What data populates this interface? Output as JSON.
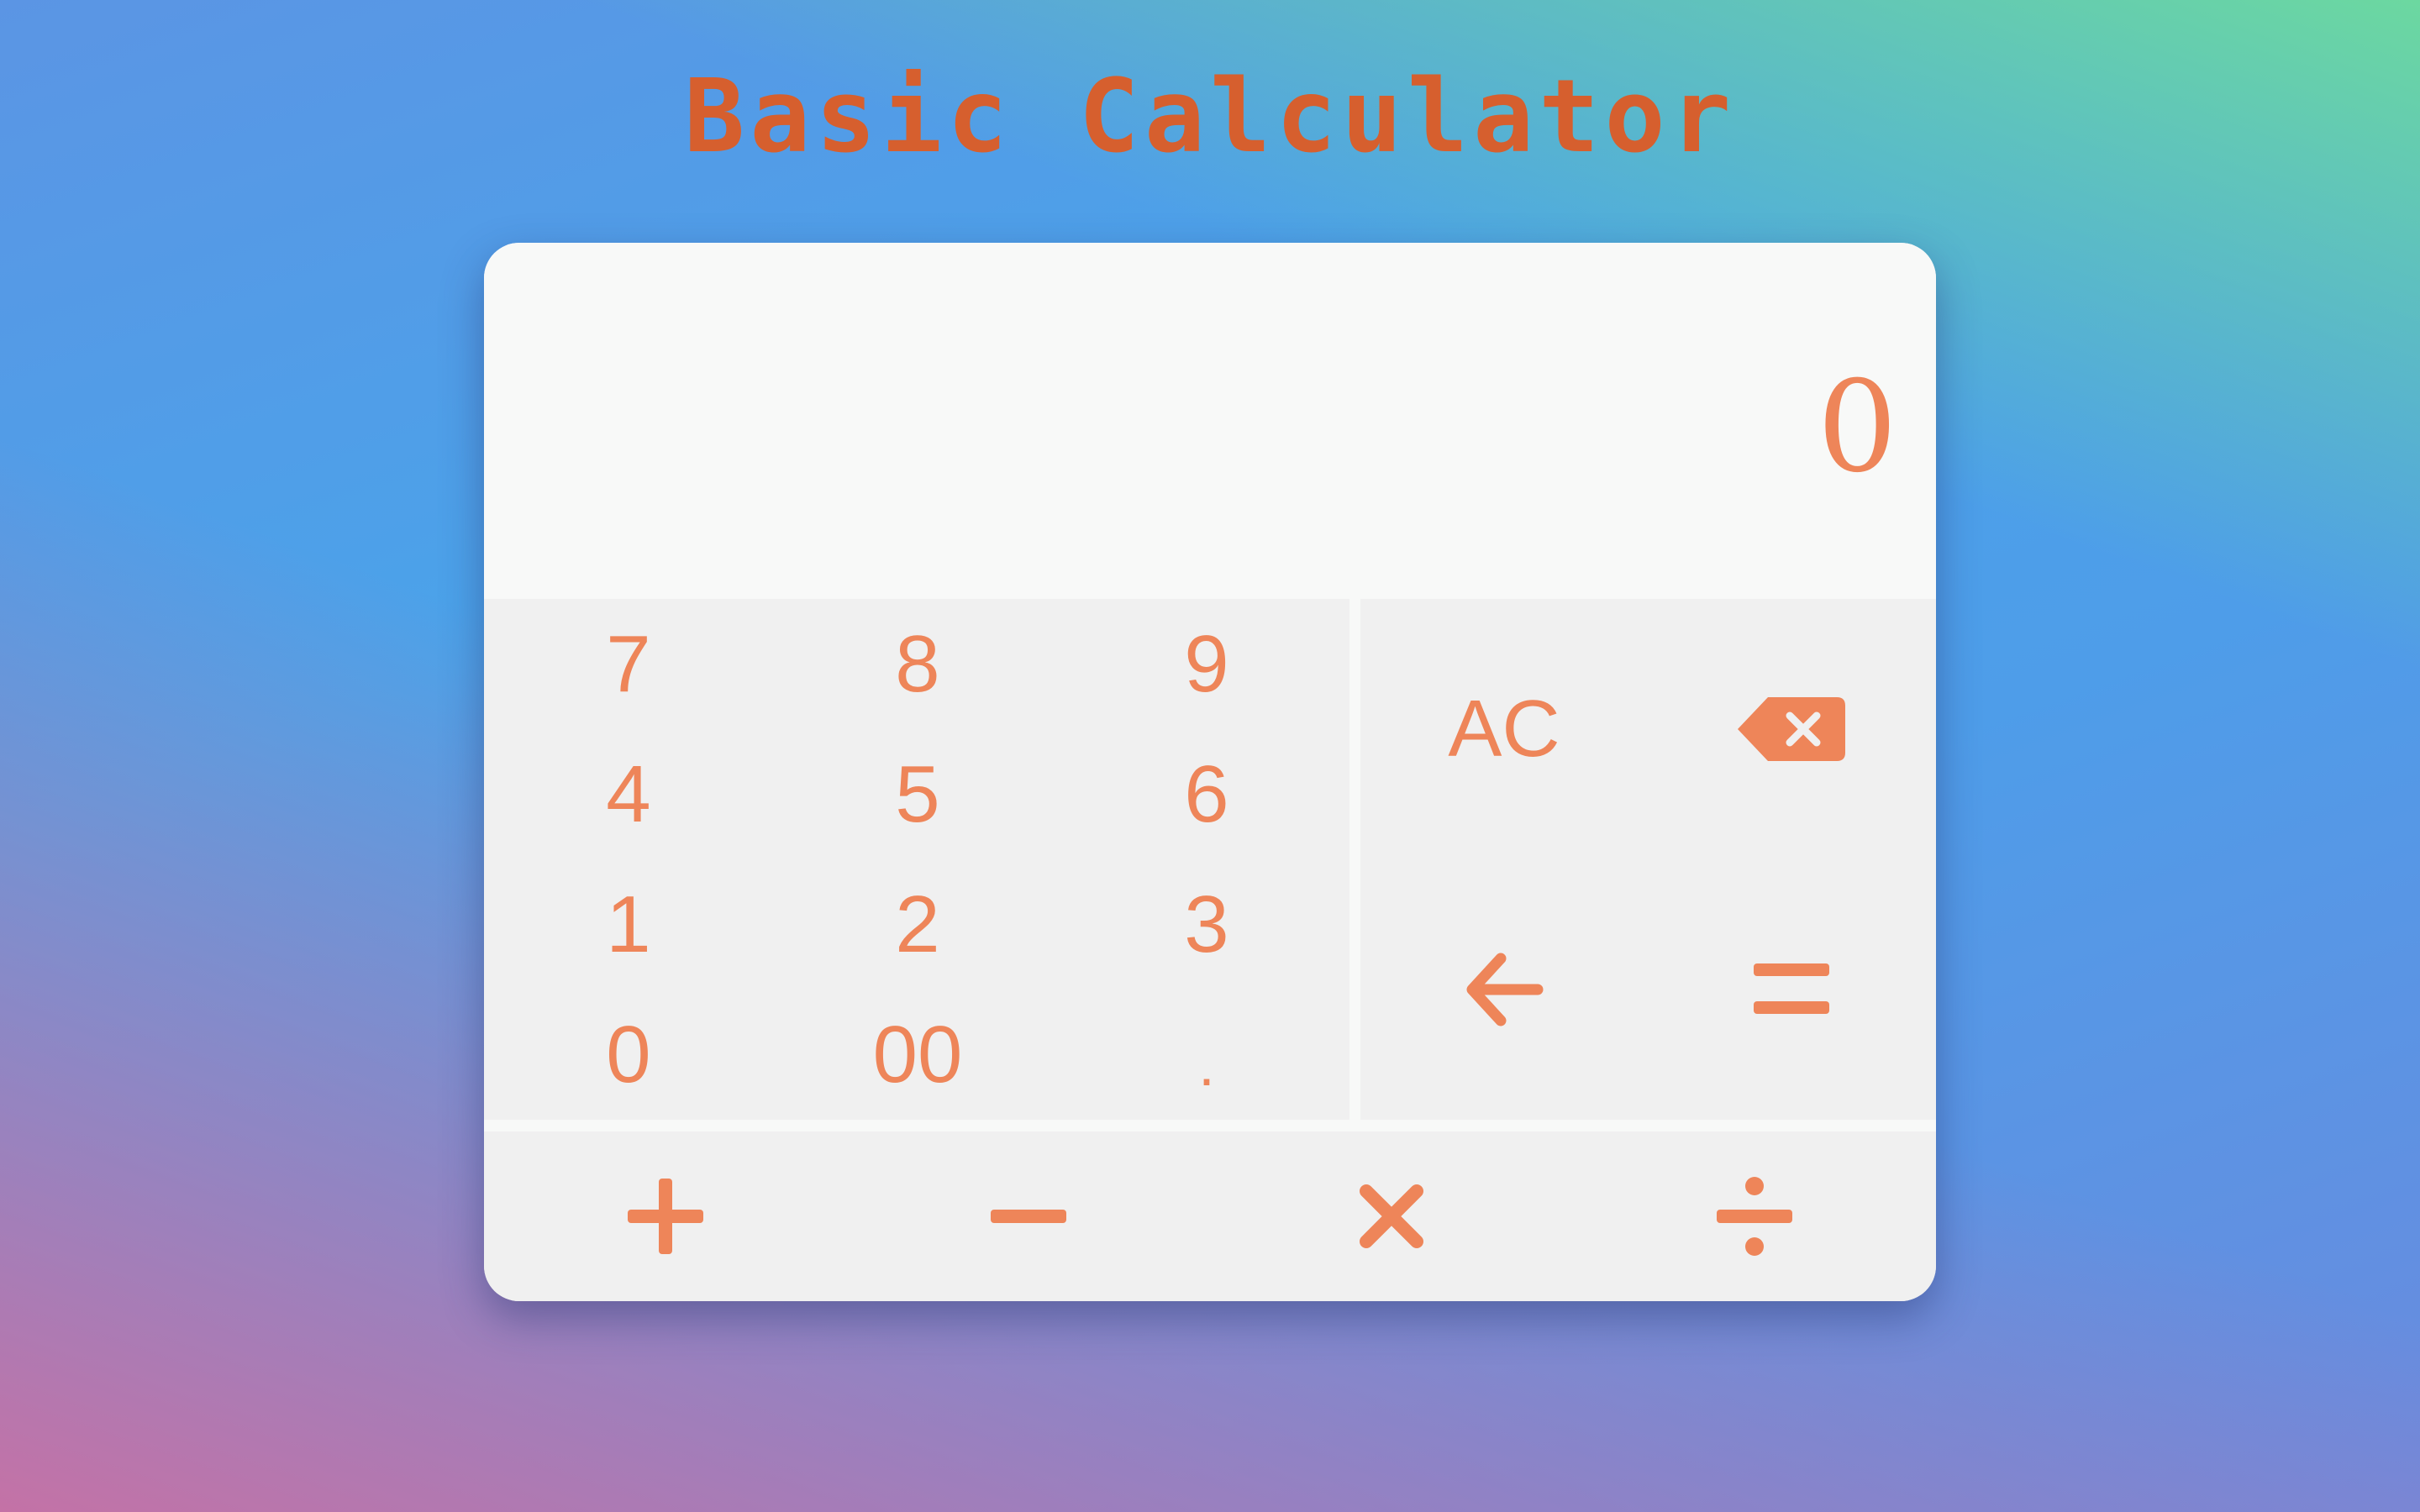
{
  "title": "Basic Calculator",
  "display": {
    "value": "0"
  },
  "digits": {
    "k7": "7",
    "k8": "8",
    "k9": "9",
    "k4": "4",
    "k5": "5",
    "k6": "6",
    "k1": "1",
    "k2": "2",
    "k3": "3",
    "k0": "0",
    "k00": "00",
    "kdot": "."
  },
  "controls": {
    "clear_label": "AC",
    "backspace_icon": "backspace-icon",
    "back_icon": "arrow-left-icon",
    "equals_icon": "equals-icon"
  },
  "operators": {
    "add_icon": "plus-icon",
    "subtract_icon": "minus-icon",
    "multiply_icon": "multiply-icon",
    "divide_icon": "divide-icon"
  },
  "colors": {
    "accent": "#ee8559",
    "title": "#d65f2e",
    "display_bg": "#f8f9f8",
    "keypad_bg": "#f0f0f0"
  }
}
